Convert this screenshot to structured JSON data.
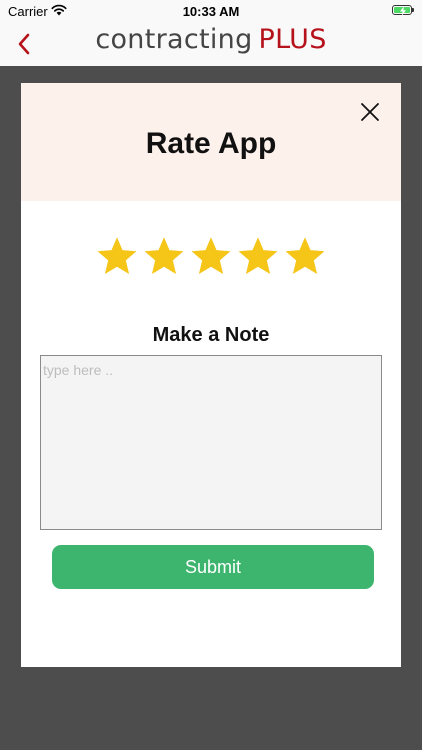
{
  "status_bar": {
    "carrier": "Carrier",
    "time": "10:33 AM",
    "wifi_icon": "wifi-icon",
    "battery_icon": "battery-charging-icon",
    "battery_color": "#4cd964"
  },
  "nav_bar": {
    "back_icon": "chevron-left-icon",
    "brand_part1": "contracting",
    "brand_part2": "PLUS",
    "accent_color": "#b5121b"
  },
  "modal": {
    "title": "Rate App",
    "close_icon": "close-icon",
    "rating": 5,
    "rating_max": 5,
    "star_color": "#f5c518",
    "note_label": "Make a Note",
    "note_value": "",
    "note_placeholder": "type here ..",
    "submit_label": "Submit",
    "submit_color": "#3db56e",
    "header_color": "#fdf1ec"
  }
}
